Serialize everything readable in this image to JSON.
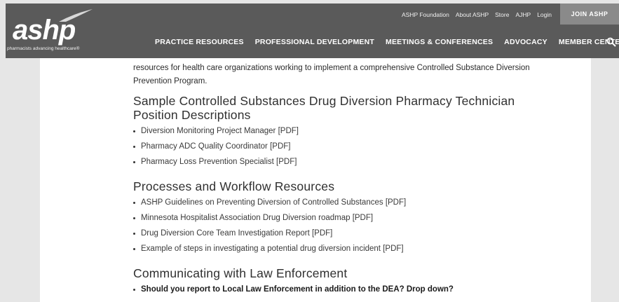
{
  "header": {
    "logo_text": "ashp",
    "tagline": "pharmacists advancing healthcare®",
    "utility_links": [
      "ASHP Foundation",
      "About ASHP",
      "Store",
      "AJHP",
      "Login"
    ],
    "join_label": "JOIN ASHP",
    "main_nav": [
      "PRACTICE RESOURCES",
      "PROFESSIONAL DEVELOPMENT",
      "MEETINGS & CONFERENCES",
      "ADVOCACY",
      "MEMBER CENTER"
    ]
  },
  "content": {
    "intro": "resources for health care organizations working to implement a comprehensive Controlled Substance Diversion Prevention Program.",
    "sections": [
      {
        "heading": "Sample Controlled Substances Drug Diversion Pharmacy Technician Position Descriptions",
        "items": [
          "Diversion Monitoring Project Manager [PDF]",
          "Pharmacy ADC Quality Coordinator [PDF]",
          "Pharmacy Loss Prevention Specialist [PDF]"
        ]
      },
      {
        "heading": "Processes and Workflow Resources",
        "items": [
          "ASHP Guidelines on Preventing Diversion of Controlled Substances [PDF]",
          "Minnesota Hospitalist Association Drug Diversion roadmap [PDF]",
          "Drug Diversion Core Team Investigation Report [PDF]",
          "Example of steps in investigating a potential drug diversion incident [PDF]"
        ]
      },
      {
        "heading": "Communicating with Law Enforcement",
        "items": [
          "Should you report to Local Law Enforcement in addition to the DEA? Drop down?"
        ]
      }
    ]
  }
}
